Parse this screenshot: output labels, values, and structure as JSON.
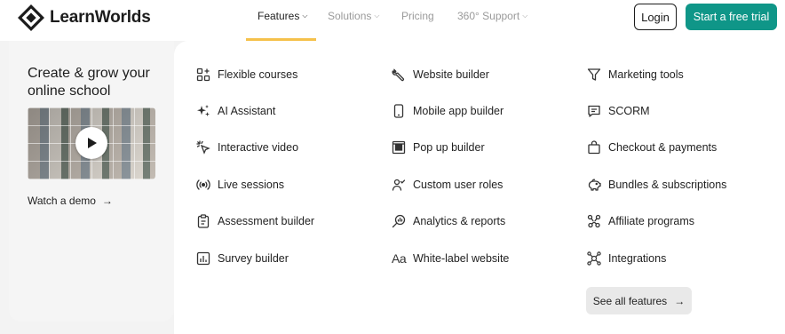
{
  "brand": {
    "name": "LearnWorlds"
  },
  "nav": {
    "items": [
      {
        "label": "Features",
        "active": true,
        "has_dropdown": true
      },
      {
        "label": "Solutions",
        "active": false,
        "has_dropdown": true
      },
      {
        "label": "Pricing",
        "active": false,
        "has_dropdown": false
      },
      {
        "label": "360° Support",
        "active": false,
        "has_dropdown": true
      }
    ]
  },
  "header_buttons": {
    "login": "Login",
    "trial": "Start a free trial"
  },
  "promo": {
    "title": "Create & grow your online school",
    "video_icon": "play-icon",
    "watch_demo": "Watch a demo",
    "arrow": "→"
  },
  "features": {
    "column1": [
      {
        "label": "Flexible courses",
        "icon": "grid-plus-icon"
      },
      {
        "label": "AI Assistant",
        "icon": "sparkle-icon"
      },
      {
        "label": "Interactive video",
        "icon": "cursor-click-icon"
      },
      {
        "label": "Live sessions",
        "icon": "broadcast-icon"
      },
      {
        "label": "Assessment builder",
        "icon": "clipboard-icon"
      },
      {
        "label": "Survey builder",
        "icon": "bar-chart-icon"
      }
    ],
    "column2": [
      {
        "label": "Website builder",
        "icon": "wrench-icon"
      },
      {
        "label": "Mobile app builder",
        "icon": "phone-icon"
      },
      {
        "label": "Pop up builder",
        "icon": "popup-icon"
      },
      {
        "label": "Custom user roles",
        "icon": "users-check-icon"
      },
      {
        "label": "Analytics & reports",
        "icon": "search-analytics-icon"
      },
      {
        "label": "White-label website",
        "icon": "font-icon"
      }
    ],
    "column3": [
      {
        "label": "Marketing tools",
        "icon": "funnel-icon"
      },
      {
        "label": "SCORM",
        "icon": "chat-icon"
      },
      {
        "label": "Checkout & payments",
        "icon": "shopping-bag-icon"
      },
      {
        "label": "Bundles & subscriptions",
        "icon": "piggy-bank-icon"
      },
      {
        "label": "Affiliate programs",
        "icon": "network-icon"
      },
      {
        "label": "Integrations",
        "icon": "integrations-icon"
      }
    ],
    "see_all": "See all features",
    "see_all_arrow": "→",
    "font_icon_text": "Aa"
  },
  "colors": {
    "accent": "#0f9688",
    "underline": "#f5c14b",
    "text": "#1f1f1f",
    "muted": "#9a9a9a"
  }
}
